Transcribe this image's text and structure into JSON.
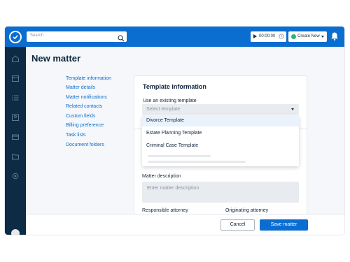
{
  "colors": {
    "brand": "#0a6ed1",
    "sidebar": "#0d2b45",
    "create_dot": "#2bb673"
  },
  "header": {
    "search_placeholder": "Search",
    "timer_value": "00:00:00",
    "create_new_label": "Create New"
  },
  "page": {
    "title": "New matter"
  },
  "nav": {
    "items": [
      "Template information",
      "Matter details",
      "Matter notifications",
      "Related contacts",
      "Custom fields",
      "Billing preference",
      "Task lists",
      "Document folders"
    ]
  },
  "template_section": {
    "heading": "Template information",
    "use_existing_label": "Use an existing template",
    "select_placeholder": "Select template",
    "options": [
      "Divorce Template",
      "Estate Planning Template",
      "Criminal Case Template"
    ]
  },
  "matter_section": {
    "description_label": "Matter description",
    "description_placeholder": "Enter matter description",
    "responsible_attorney_label": "Responsible attorney",
    "originating_attorney_label": "Originating attorney"
  },
  "footer": {
    "cancel_label": "Cancel",
    "save_label": "Save matter"
  }
}
